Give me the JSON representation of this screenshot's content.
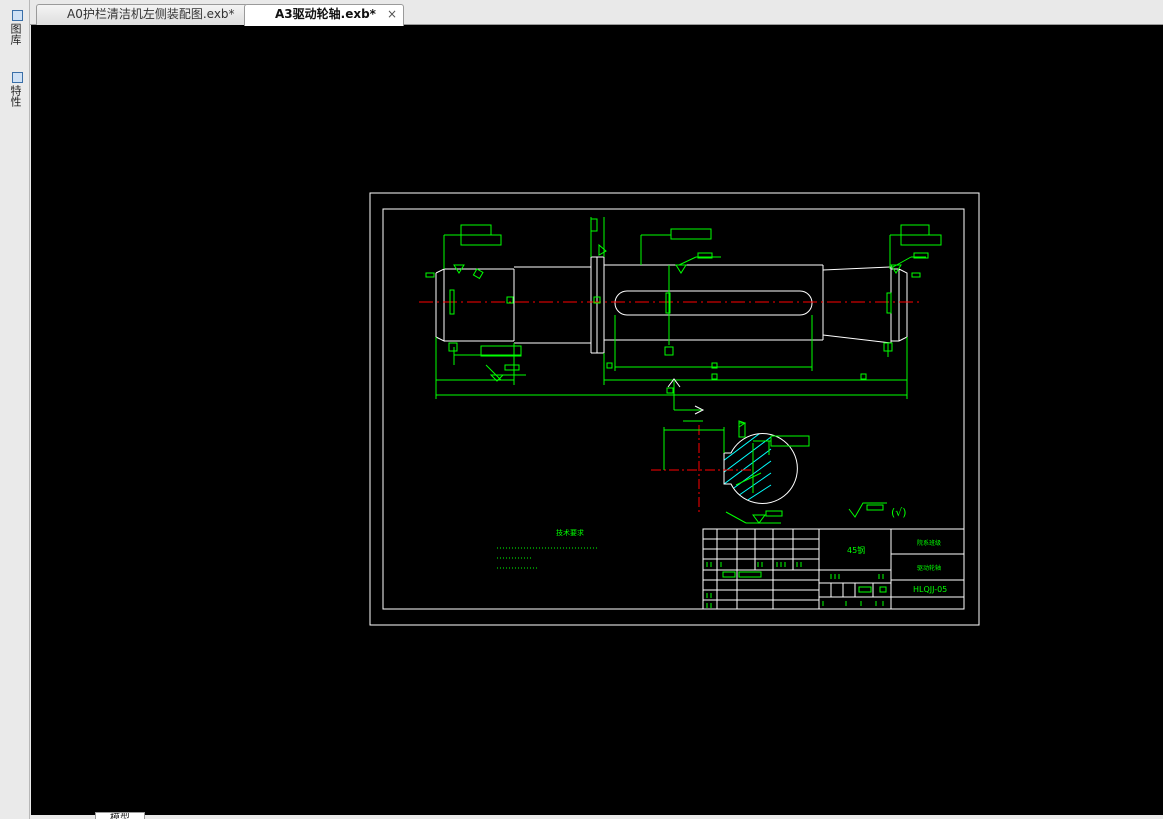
{
  "tabs": [
    {
      "label": "A0护栏清洁机左侧装配图.exb*",
      "active": false
    },
    {
      "label": "A3驱动轮轴.exb*",
      "active": true,
      "close_glyph": "×"
    }
  ],
  "side_panel": {
    "items": [
      {
        "label": "图库",
        "icon": "library-icon"
      },
      {
        "label": "特性",
        "icon": "properties-icon"
      }
    ]
  },
  "bottom_tabs": [
    {
      "label": "模型"
    }
  ],
  "drawing": {
    "material": "45钢",
    "company": "院系班级",
    "part_name": "驱动轮轴",
    "drawing_number": "HLQJJ-05",
    "tech_req_title": "技术要求",
    "roughness_symbol": "(√)"
  },
  "colors": {
    "canvas_bg": "#000000",
    "frame": "#ffffff",
    "dimension": "#00ff00",
    "centerline": "#ff0000",
    "hatch": "#00ffff"
  }
}
